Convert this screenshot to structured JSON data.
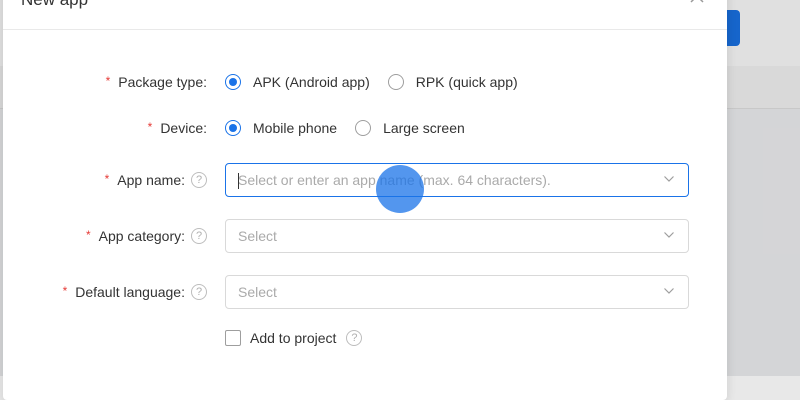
{
  "modal": {
    "title": "New app",
    "close_icon": "close-icon"
  },
  "form": {
    "package_type": {
      "label": "Package type:",
      "required": true,
      "options": [
        {
          "label": "APK (Android app)",
          "checked": true
        },
        {
          "label": "RPK (quick app)",
          "checked": false
        }
      ]
    },
    "device": {
      "label": "Device:",
      "required": true,
      "options": [
        {
          "label": "Mobile phone",
          "checked": true
        },
        {
          "label": "Large screen",
          "checked": false
        }
      ]
    },
    "app_name": {
      "label": "App name:",
      "required": true,
      "help_icon": "question-circle-icon",
      "placeholder": "Select or enter an app name (max. 64 characters).",
      "value": "",
      "focused": true
    },
    "app_category": {
      "label": "App category:",
      "required": true,
      "help_icon": "question-circle-icon",
      "placeholder": "Select"
    },
    "default_language": {
      "label": "Default language:",
      "required": true,
      "help_icon": "question-circle-icon",
      "placeholder": "Select"
    },
    "add_to_project": {
      "label": "Add to project",
      "checked": false,
      "help_icon": "question-circle-icon"
    }
  },
  "required_marker": "*",
  "help_glyph": "?",
  "colors": {
    "accent": "#1a73e8",
    "required": "#e53935",
    "border": "#d9d9d9",
    "placeholder": "#aaaaaa"
  }
}
